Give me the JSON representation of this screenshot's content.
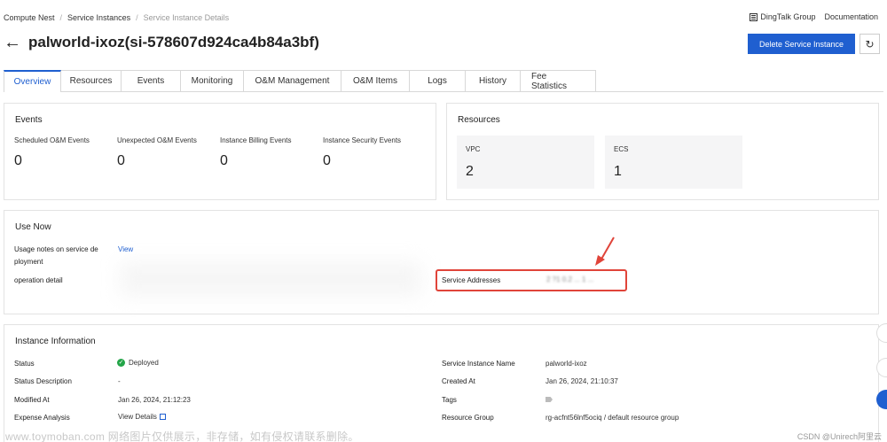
{
  "breadcrumb": [
    "Compute Nest",
    "Service Instances",
    "Service Instance Details"
  ],
  "top_links": {
    "dingtalk": "DingTalk Group",
    "documentation": "Documentation"
  },
  "header": {
    "back_glyph": "←",
    "title": "palworld-ixoz(si-578607d924ca4b84a3bf)",
    "delete_label": "Delete Service Instance",
    "refresh_glyph": "↻"
  },
  "tabs": [
    "Overview",
    "Resources",
    "Events",
    "Monitoring",
    "O&M Management",
    "O&M Items",
    "Logs",
    "History",
    "Fee Statistics"
  ],
  "active_tab": "Overview",
  "events": {
    "title": "Events",
    "metrics": [
      {
        "label": "Scheduled O&M Events",
        "value": "0"
      },
      {
        "label": "Unexpected O&M Events",
        "value": "0"
      },
      {
        "label": "Instance Billing Events",
        "value": "0"
      },
      {
        "label": "Instance Security Events",
        "value": "0"
      }
    ]
  },
  "resources": {
    "title": "Resources",
    "cards": [
      {
        "label": "VPC",
        "value": "2"
      },
      {
        "label": "ECS",
        "value": "1"
      }
    ]
  },
  "use_now": {
    "title": "Use Now",
    "usage_notes_label_1": "Usage notes on service de",
    "usage_notes_label_2": "ployment",
    "usage_notes_link": "View",
    "operation_detail_label": "operation detail",
    "service_addresses_label": "Service Addresses",
    "service_addresses_value": "2 ?1 0.2 ... 1 ..."
  },
  "instance_info": {
    "title": "Instance Information",
    "status_label": "Status",
    "status_value": "Deployed",
    "status_desc_label": "Status Description",
    "status_desc_value": "-",
    "modified_label": "Modified At",
    "modified_value": "Jan 26, 2024, 21:12:23",
    "expense_label": "Expense Analysis",
    "expense_link": "View Details",
    "name_label": "Service Instance Name",
    "name_value": "palworld-ixoz",
    "created_label": "Created At",
    "created_value": "Jan 26, 2024, 21:10:37",
    "tags_label": "Tags",
    "rg_label": "Resource Group",
    "rg_value": "rg-acfnt56lnf5ociq / default resource group"
  },
  "watermark": "www.toymoban.com 网络图片仅供展示，非存储，如有侵权请联系删除。",
  "csdn": "CSDN @Unirech阿里云",
  "colors": {
    "primary": "#1f5fd0",
    "highlight": "#e0443a",
    "success": "#23a548"
  }
}
